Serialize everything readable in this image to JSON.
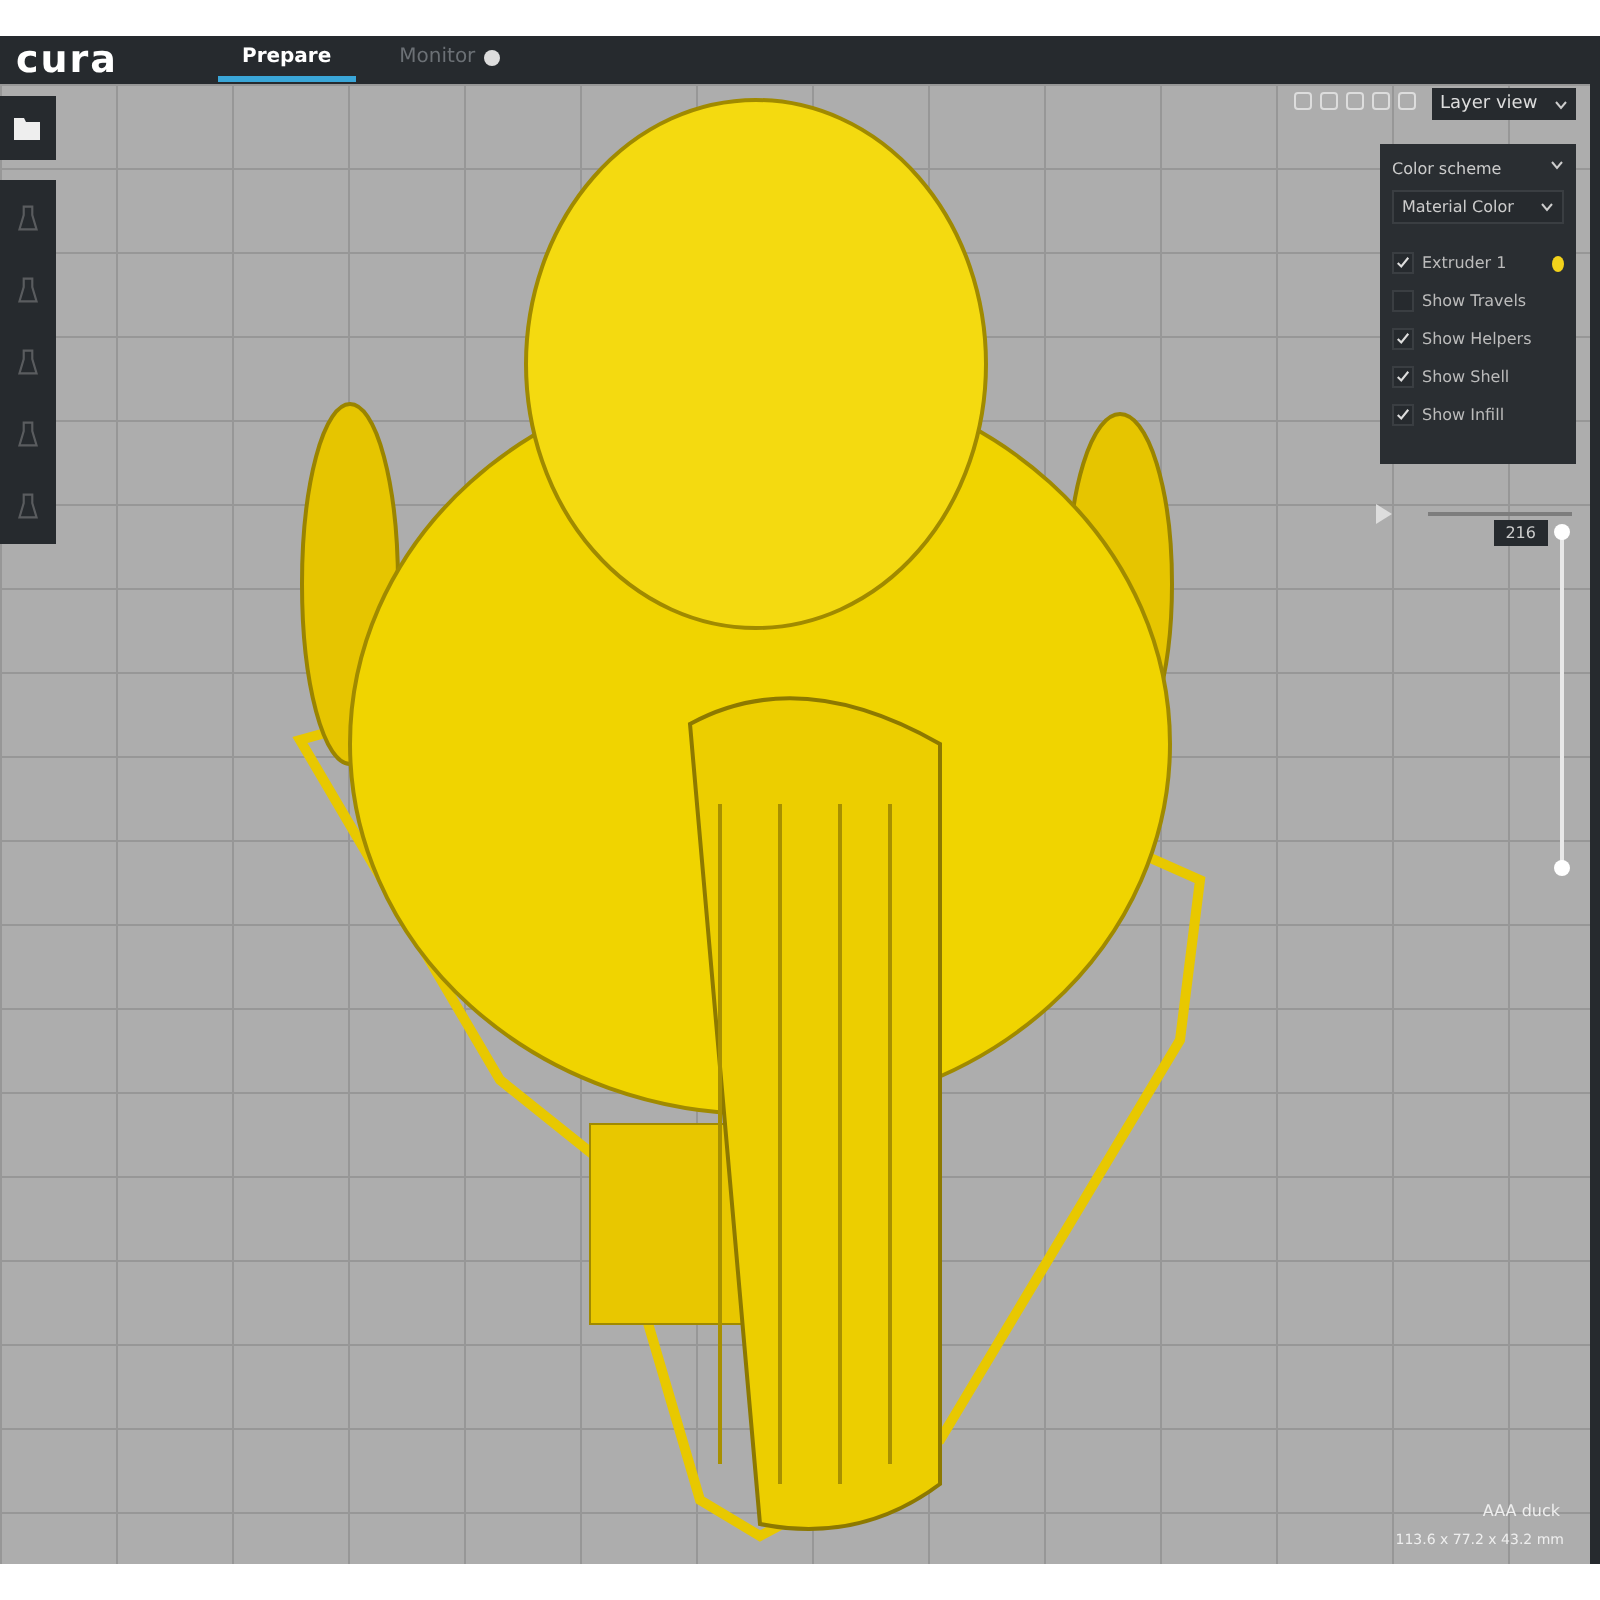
{
  "header": {
    "logo": "cura",
    "tabs": [
      {
        "label": "Prepare",
        "selected": true
      },
      {
        "label": "Monitor",
        "selected": false
      }
    ]
  },
  "toolbar": {
    "tools": [
      {
        "disabled": true
      },
      {
        "disabled": true
      },
      {
        "disabled": true
      },
      {
        "disabled": true
      },
      {
        "disabled": true
      }
    ]
  },
  "view_menu": {
    "value": "Layer view"
  },
  "layer_panel": {
    "title": "Color scheme",
    "scheme": "Material Color",
    "extruders": [
      {
        "label": "Extruder 1",
        "checked": true,
        "color": "#f2d21b"
      }
    ],
    "options": [
      {
        "label": "Show Travels",
        "checked": false
      },
      {
        "label": "Show Helpers",
        "checked": true
      },
      {
        "label": "Show Shell",
        "checked": true
      },
      {
        "label": "Show Infill",
        "checked": true
      }
    ]
  },
  "layer_slider": {
    "value": "216",
    "level": 1
  },
  "object_info": {
    "name": "AAA duck",
    "size": "113.6 x 77.2 x 43.2 mm"
  }
}
